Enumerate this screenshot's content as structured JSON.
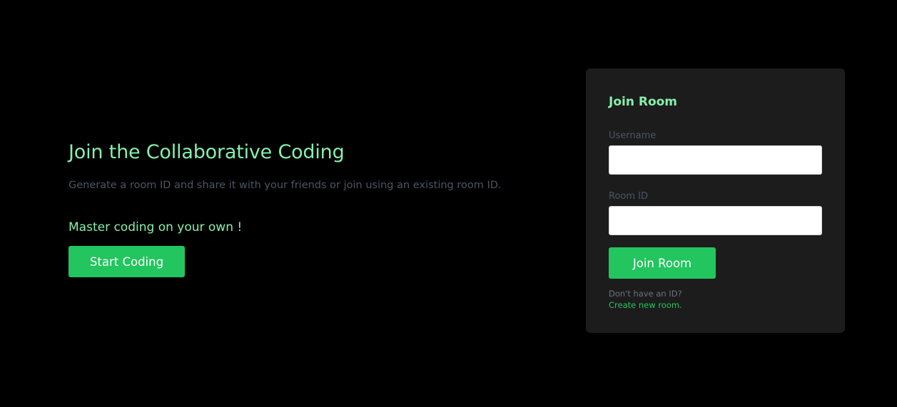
{
  "hero": {
    "title": "Join the Collaborative Coding",
    "subtitle": "Generate a room ID and share it with your friends or join using an existing room ID.",
    "tagline": "Master coding on your own !",
    "start_button_label": "Start Coding"
  },
  "join_card": {
    "title": "Join Room",
    "username_label": "Username",
    "username_value": "",
    "room_id_label": "Room ID",
    "room_id_value": "",
    "join_button_label": "Join Room",
    "no_id_hint": "Don't have an ID?",
    "create_link_label": "Create new room."
  },
  "colors": {
    "background": "#000000",
    "card_background": "#1c1c1c",
    "accent_text": "#86efac",
    "button_green": "#22c55e",
    "muted_text": "#4b5563"
  }
}
